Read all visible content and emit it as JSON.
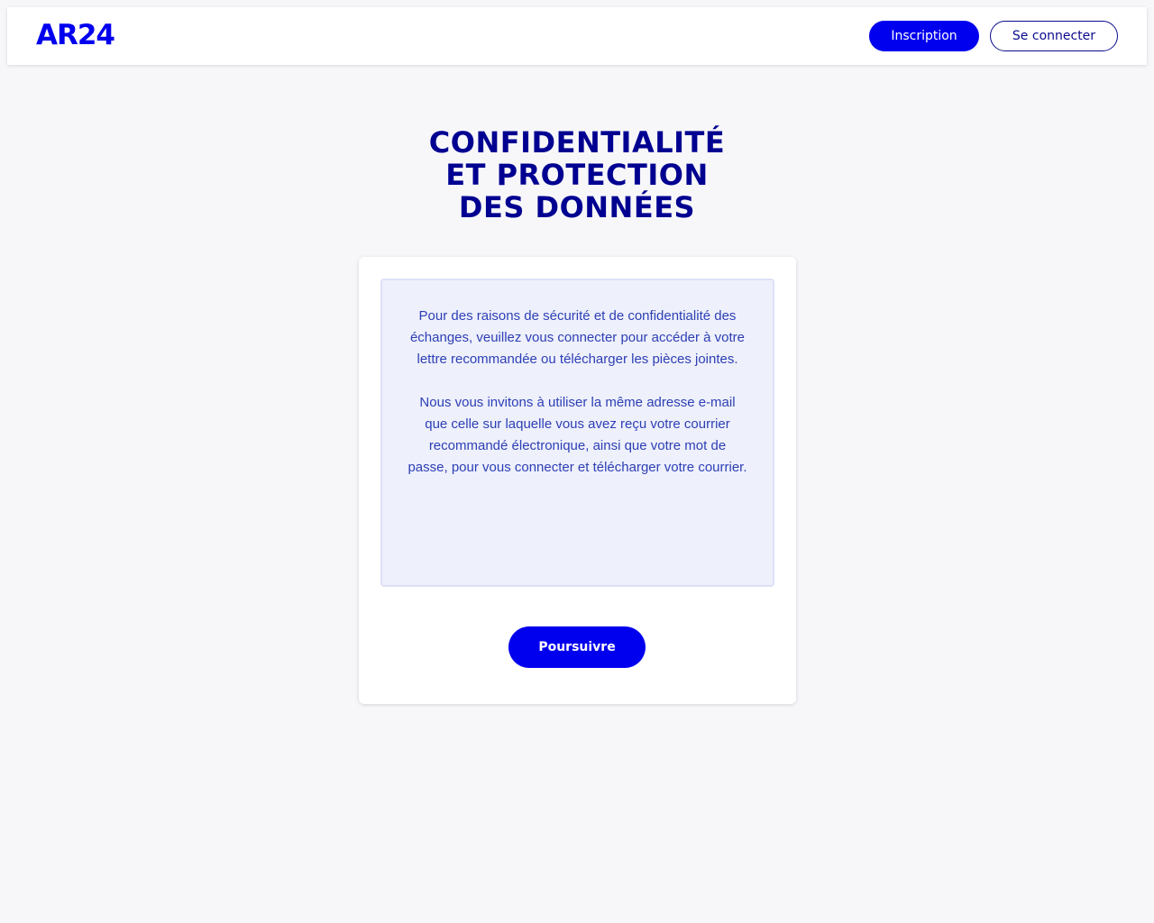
{
  "header": {
    "logo_text": "AR24",
    "signup_label": "Inscription",
    "login_label": "Se connecter"
  },
  "main": {
    "title_lines": [
      "CONFIDENTIALITÉ",
      "ET PROTECTION",
      "DES DONNÉES"
    ],
    "notice": {
      "paragraph_1": "Pour des raisons de sécurité et de confidentialité des échanges, veuillez vous connecter pour accéder à votre lettre recommandée ou télécharger les pièces jointes.",
      "paragraph_2": "Nous vous invitons à utiliser la même adresse e-mail que celle sur laquelle vous avez reçu votre courrier recommandé électronique, ainsi que votre mot de passe, pour vous connecter et télécharger votre courrier."
    },
    "continue_label": "Poursuivre"
  },
  "colors": {
    "brand": "#0000ee",
    "title": "#000091",
    "notice_text": "#2d3fb5",
    "notice_bg": "#eef0fb",
    "page_bg": "#f7f7fa"
  }
}
